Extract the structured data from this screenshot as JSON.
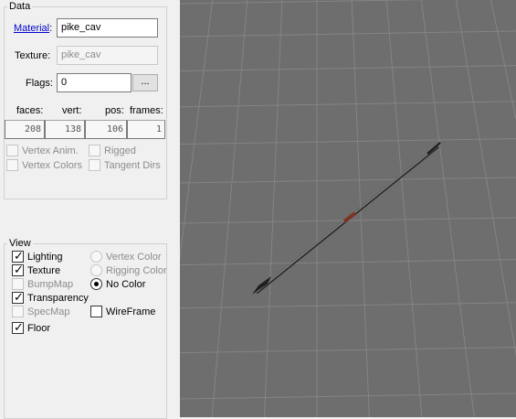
{
  "data_group": {
    "title": "Data",
    "material_label": "Material",
    "material_colon": ":",
    "material_value": "pike_cav",
    "texture_label": "Texture:",
    "texture_value": "pike_cav",
    "flags_label": "Flags:",
    "flags_value": "0",
    "browse_button": "...",
    "faces_label": "faces:",
    "vert_label": "vert:",
    "pos_label": "pos:",
    "frames_label": "frames:",
    "faces_value": "208",
    "vert_value": "138",
    "pos_value": "106",
    "frames_value": "1",
    "vertex_anim": {
      "label": "Vertex Anim.",
      "checked": false,
      "enabled": false
    },
    "rigged": {
      "label": "Rigged",
      "checked": false,
      "enabled": false
    },
    "vertex_colors": {
      "label": "Vertex Colors",
      "checked": false,
      "enabled": false
    },
    "tangent_dirs": {
      "label": "Tangent Dirs",
      "checked": false,
      "enabled": false
    }
  },
  "view_group": {
    "title": "View",
    "lighting": {
      "label": "Lighting",
      "checked": true,
      "enabled": true
    },
    "texture": {
      "label": "Texture",
      "checked": true,
      "enabled": true
    },
    "bumpmap": {
      "label": "BumpMap",
      "checked": false,
      "enabled": false
    },
    "transparency": {
      "label": "Transparency",
      "checked": true,
      "enabled": true
    },
    "specmap": {
      "label": "SpecMap",
      "checked": false,
      "enabled": false
    },
    "floor": {
      "label": "Floor",
      "checked": true,
      "enabled": true
    },
    "vertex_color": {
      "label": "Vertex Color",
      "selected": false,
      "enabled": false
    },
    "rigging_color": {
      "label": "Rigging Color",
      "selected": false,
      "enabled": false
    },
    "no_color": {
      "label": "No Color",
      "selected": true,
      "enabled": true
    },
    "wireframe": {
      "label": "WireFrame",
      "checked": false,
      "enabled": true
    }
  },
  "viewport": {
    "background": "#6e6e6e",
    "grid_color": "#848484",
    "model": "pike_cav"
  },
  "colors": {
    "link": "#0000cc",
    "panel": "#f0f0f0",
    "disabled_text": "#8c8c8c"
  }
}
